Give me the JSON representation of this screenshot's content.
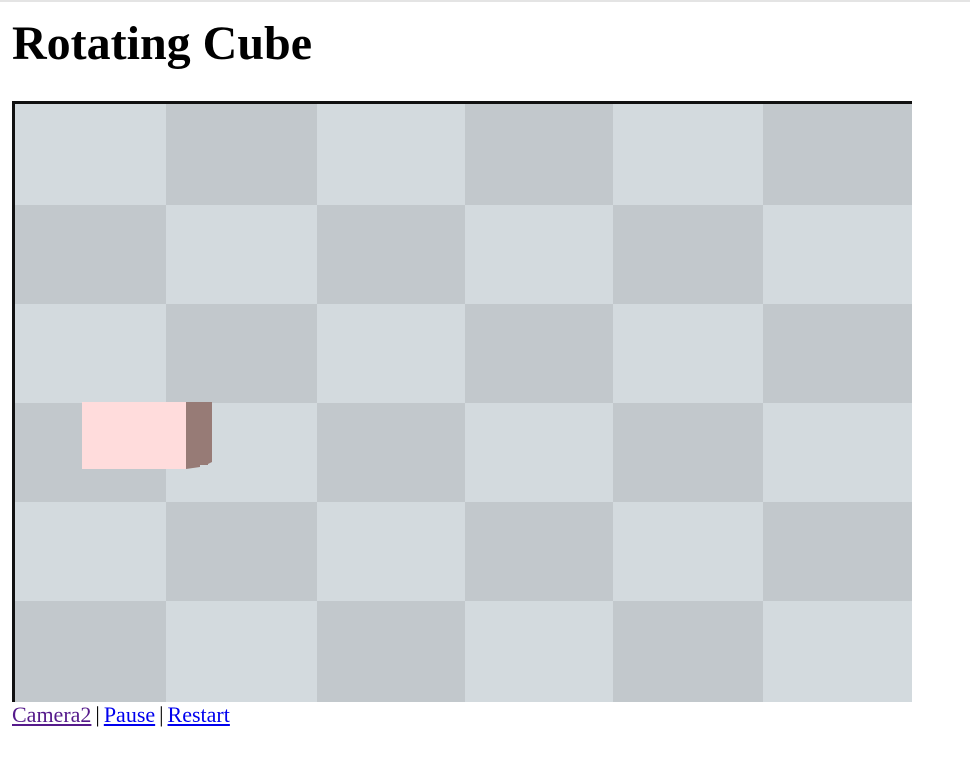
{
  "page": {
    "title": "Rotating Cube"
  },
  "scene": {
    "floor_light_color": "#d3dade",
    "floor_dark_color": "#c2c8cc",
    "border_color": "#111111",
    "cube_front_color": "#ffdcdc",
    "cube_side_color": "#977b76"
  },
  "controls": {
    "links": [
      {
        "label": "Camera2",
        "state": "visited"
      },
      {
        "label": "Pause",
        "state": "unvisited"
      },
      {
        "label": "Restart",
        "state": "unvisited"
      }
    ],
    "separator": "|"
  }
}
